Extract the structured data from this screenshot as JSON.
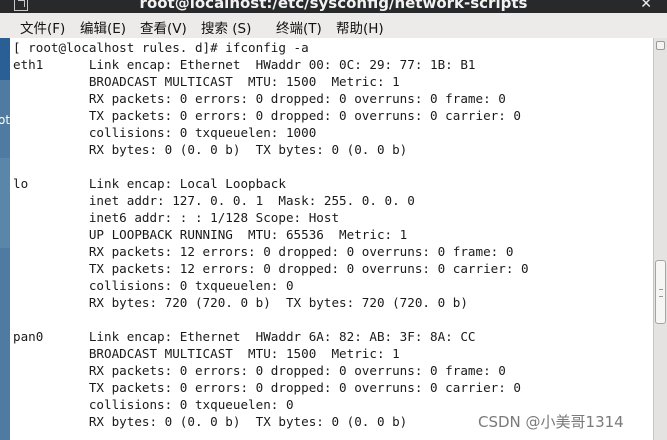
{
  "window": {
    "title": "root@localhost:/etc/sysconfig/network-scripts",
    "close_glyph": "✕"
  },
  "menu": [
    "文件(F)",
    "编辑(E)",
    "查看(V)",
    "搜索 (S)",
    "终端(T)",
    "帮助(H)"
  ],
  "side_fragment": "ot",
  "terminal": {
    "lines": [
      "[ root@localhost rules. d]# ifconfig -a",
      "eth1      Link encap: Ethernet  HWaddr 00: 0C: 29: 77: 1B: B1",
      "          BROADCAST MULTICAST  MTU: 1500  Metric: 1",
      "          RX packets: 0 errors: 0 dropped: 0 overruns: 0 frame: 0",
      "          TX packets: 0 errors: 0 dropped: 0 overruns: 0 carrier: 0",
      "          collisions: 0 txqueuelen: 1000",
      "          RX bytes: 0 (0. 0 b)  TX bytes: 0 (0. 0 b)",
      "",
      "lo        Link encap: Local Loopback",
      "          inet addr: 127. 0. 0. 1  Mask: 255. 0. 0. 0",
      "          inet6 addr: : : 1/128 Scope: Host",
      "          UP LOOPBACK RUNNING  MTU: 65536  Metric: 1",
      "          RX packets: 12 errors: 0 dropped: 0 overruns: 0 frame: 0",
      "          TX packets: 12 errors: 0 dropped: 0 overruns: 0 carrier: 0",
      "          collisions: 0 txqueuelen: 0",
      "          RX bytes: 720 (720. 0 b)  TX bytes: 720 (720. 0 b)",
      "",
      "pan0      Link encap: Ethernet  HWaddr 6A: 82: AB: 3F: 8A: CC",
      "          BROADCAST MULTICAST  MTU: 1500  Metric: 1",
      "          RX packets: 0 errors: 0 dropped: 0 overruns: 0 frame: 0",
      "          TX packets: 0 errors: 0 dropped: 0 overruns: 0 carrier: 0",
      "          collisions: 0 txqueuelen: 0",
      "          RX bytes: 0 (0. 0 b)  TX bytes: 0 (0. 0 b)"
    ]
  },
  "watermark": "CSDN @小美哥1314"
}
